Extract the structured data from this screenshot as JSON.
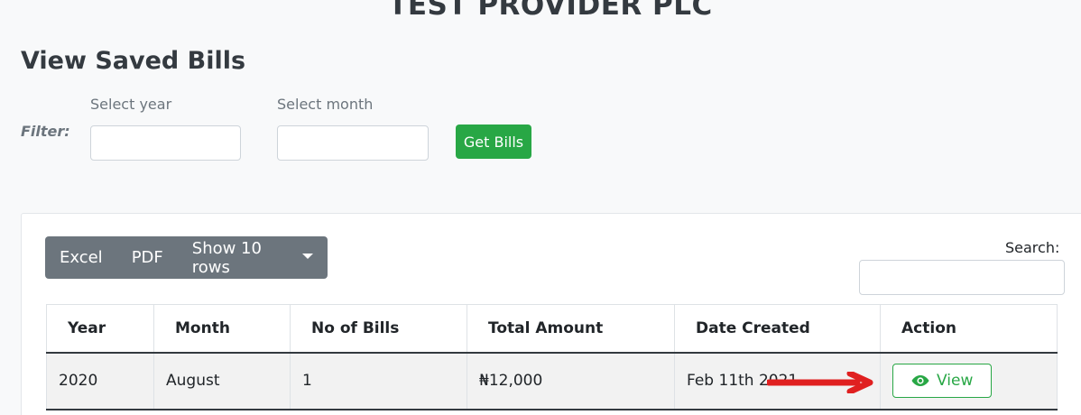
{
  "header": {
    "company": "TEST PROVIDER PLC",
    "page_title": "View Saved Bills"
  },
  "filter": {
    "label": "Filter:",
    "year_label": "Select year",
    "year_value": "",
    "month_label": "Select month",
    "month_value": "",
    "submit_label": "Get Bills"
  },
  "toolbar": {
    "excel_label": "Excel",
    "pdf_label": "PDF",
    "rows_label": "Show 10 rows",
    "search_label": "Search:",
    "search_value": ""
  },
  "table": {
    "columns": [
      "Year",
      "Month",
      "No of Bills",
      "Total Amount",
      "Date Created",
      "Action"
    ],
    "rows": [
      {
        "year": "2020",
        "month": "August",
        "bills": "1",
        "amount": "₦12,000",
        "date": "Feb 11th 2021",
        "action": "View"
      }
    ]
  },
  "colors": {
    "success": "#28a745",
    "secondary": "#6c757d",
    "annotation_arrow": "#e02020"
  },
  "icons": {
    "view": "eye-icon",
    "dropdown": "caret-down-icon"
  }
}
